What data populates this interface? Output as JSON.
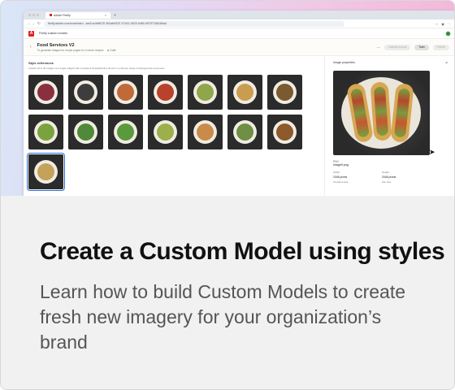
{
  "browser": {
    "tab_title": "Adobe Firefly",
    "new_tab": "+",
    "url": "firefly.adobe.com/cms/train/...aed/.sc/d6ECE-B2/ab931F-37161-4523-9480-95797158189a4",
    "nav_icons": [
      "back-icon",
      "forward-icon",
      "reload-icon"
    ]
  },
  "app": {
    "breadcrumb": "Firefly custom models",
    "logo": "A"
  },
  "model": {
    "title": "Food Services V2",
    "subtitle": "To generate images for recipe pages for in-store recipes",
    "status": "Draft",
    "more": "…",
    "actions": [
      "Validate prompt",
      "Train",
      "Publish"
    ]
  },
  "styles": {
    "title": "Style references",
    "description": "Include 10 to 30 images of a single subject with consistent characteristics shown in a diverse range of backgrounds and poses",
    "thumbnails": [
      {
        "name": "dish-1",
        "color": "#8a2f3e"
      },
      {
        "name": "dish-2",
        "color": "#3d3d3d"
      },
      {
        "name": "dish-3",
        "color": "#c06a3a"
      },
      {
        "name": "dish-4",
        "color": "#b8422c"
      },
      {
        "name": "dish-5",
        "color": "#8fa64a"
      },
      {
        "name": "dish-6",
        "color": "#c99d4f"
      },
      {
        "name": "dish-7",
        "color": "#7a5a2e"
      },
      {
        "name": "dish-8",
        "color": "#7aa23e"
      },
      {
        "name": "dish-9",
        "color": "#4f8a3a"
      },
      {
        "name": "dish-10",
        "color": "#5b9a3c"
      },
      {
        "name": "dish-11",
        "color": "#9bb04a"
      },
      {
        "name": "dish-12",
        "color": "#c98b4a"
      },
      {
        "name": "dish-13",
        "color": "#6e8f45"
      },
      {
        "name": "dish-14",
        "color": "#8c5a2c"
      },
      {
        "name": "dish-15",
        "color": "#c4a25a",
        "selected": true
      }
    ]
  },
  "properties": {
    "title": "Image properties",
    "close": "×",
    "format": "PNG",
    "filename": "image9.png",
    "fields": [
      {
        "label": "Width",
        "value": "2048 pixels"
      },
      {
        "label": "Height",
        "value": "2048 pixels"
      },
      {
        "label": "Creation date",
        "value": ""
      },
      {
        "label": "File size",
        "value": ""
      }
    ]
  },
  "card": {
    "headline": "Create a Custom Model using styles",
    "description": "Learn how to build Custom Models to create fresh new imagery for your organization’s brand"
  }
}
